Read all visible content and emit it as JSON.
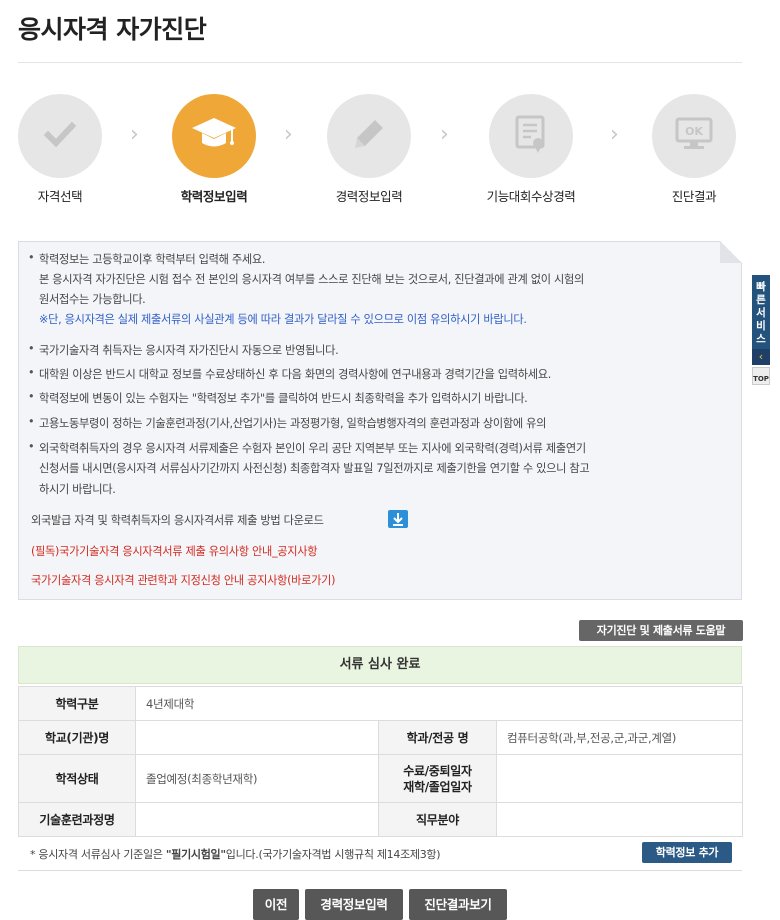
{
  "page": {
    "title": "응시자격 자가진단"
  },
  "steps": [
    {
      "label": "자격선택",
      "icon": "checkmark-icon"
    },
    {
      "label": "학력정보입력",
      "icon": "graduation-cap-icon",
      "active": true
    },
    {
      "label": "경력정보입력",
      "icon": "pencil-icon"
    },
    {
      "label": "기능대회수상경력",
      "icon": "certificate-icon"
    },
    {
      "label": "진단결과",
      "icon": "ok-monitor-icon"
    }
  ],
  "notice": {
    "l1": "학력정보는 고등학교이후 학력부터 입력해 주세요.",
    "l2": "본 응시자격 자가진단은 시험 접수 전 본인의 응시자격 여부를 스스로 진단해 보는 것으로서, 진단결과에 관계 없이 시험의",
    "l3": "원서접수는 가능합니다.",
    "l4": "※단, 응시자격은 실제 제출서류의 사실관계 등에 따라 결과가 달라질 수 있으므로 이점 유의하시기 바랍니다.",
    "l5": "국가기술자격 취득자는 응시자격 자가진단시 자동으로 반영됩니다.",
    "l6": "대학원 이상은 반드시 대학교 정보를 수료상태하신 후 다음 화면의 경력사항에 연구내용과 경력기간을 입력하세요.",
    "l7": "학력정보에 변동이 있는 수험자는 \"학력정보 추가\"를 클릭하여 반드시 최종학력을 추가 입력하시기 바랍니다.",
    "l8": "고용노동부령이 정하는 기술훈련과정(기사,산업기사)는 과정평가형, 일학습병행자격의 훈련과정과 상이함에 유의",
    "l9": "외국학력취득자의 경우 응시자격 서류제출은 수험자 본인이 우리 공단 지역본부 또는 지사에 외국학력(경력)서류 제출연기",
    "l10": "신청서를 내시면(응시자격 서류심사기간까지 사전신청) 최종합격자 발표일 7일전까지로 제출기한을 연기할 수 있으니 참고",
    "l11": "하시기 바랍니다.",
    "download": "외국발급 자격 및 학력취득자의 응시자격서류 제출 방법 다운로드",
    "download_icon": "download-icon",
    "link1": "(필독)국가기술자격 응시자격서류 제출 유의사항 안내_공지사항",
    "link2": "국가기술자격 응시자격 관련학과 지정신청 안내 공지사항(바로가기)"
  },
  "side": {
    "quick": "빠른서비스",
    "top": "TOP"
  },
  "help_button": "자기진단 및 제출서류 도움말",
  "review": {
    "status": "서류 심사 완료",
    "h_type": "학력구분",
    "v_type": "4년제대학",
    "h_school": "학교(기관)명",
    "v_school": "",
    "h_major": "학과/전공 명",
    "v_major": "컴퓨터공학(과,부,전공,군,과군,계열)",
    "h_state": "학적상태",
    "v_state": "졸업예정(최종학년재학)",
    "h_date1": "수료/중퇴일자",
    "h_date2": "재학/졸업일자",
    "v_date": "",
    "h_course": "기술훈련과정명",
    "v_course": "",
    "h_job": "직무분야",
    "v_job": ""
  },
  "footnote": {
    "prefix": "* 응시자격 서류심사 기준일은 ",
    "bold": "\"필기시험일\"",
    "suffix": "입니다.(국가기술자격법 시행규칙 제14조제3항)"
  },
  "add_button": "학력정보 추가",
  "nav": {
    "prev": "이전",
    "next": "경력정보입력",
    "result": "진단결과보기"
  },
  "colors": {
    "active_step": "#efa838",
    "inactive_step": "#e6e6e6",
    "link_red": "#d22b1f",
    "note_blue": "#2f5fc8",
    "review_bg": "#eaf5e1",
    "button_dark": "#575757",
    "button_blue": "#2a5a85"
  }
}
